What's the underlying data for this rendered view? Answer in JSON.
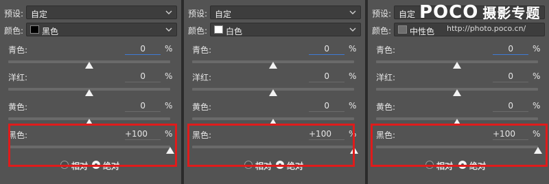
{
  "panels": [
    {
      "preset_label": "预设:",
      "preset_value": "自定",
      "color_label": "颜色:",
      "color_value": "黑色",
      "swatch_color": "#000000",
      "sliders": [
        {
          "label": "青色:",
          "value": "0",
          "unit": "%",
          "fraction": 0.5
        },
        {
          "label": "洋红:",
          "value": "0",
          "unit": "%",
          "fraction": 0.5
        },
        {
          "label": "黄色:",
          "value": "0",
          "unit": "%",
          "fraction": 0.5
        },
        {
          "label": "黑色:",
          "value": "+100",
          "unit": "%",
          "fraction": 1.0
        }
      ],
      "radio_relative": "相对",
      "radio_absolute": "绝对"
    },
    {
      "preset_label": "预设:",
      "preset_value": "自定",
      "color_label": "颜色:",
      "color_value": "白色",
      "swatch_color": "#ffffff",
      "sliders": [
        {
          "label": "青色:",
          "value": "0",
          "unit": "%",
          "fraction": 0.5
        },
        {
          "label": "洋红:",
          "value": "0",
          "unit": "%",
          "fraction": 0.5
        },
        {
          "label": "黄色:",
          "value": "0",
          "unit": "%",
          "fraction": 0.5
        },
        {
          "label": "黑色:",
          "value": "+100",
          "unit": "%",
          "fraction": 1.0
        }
      ],
      "radio_relative": "相对",
      "radio_absolute": "绝对"
    },
    {
      "preset_label": "预设:",
      "preset_value": "自定",
      "color_label": "颜色:",
      "color_value": "中性色",
      "swatch_color": "#6e6e6e",
      "sliders": [
        {
          "label": "青色:",
          "value": "0",
          "unit": "%",
          "fraction": 0.5
        },
        {
          "label": "洋红:",
          "value": "0",
          "unit": "%",
          "fraction": 0.5
        },
        {
          "label": "黄色:",
          "value": "0",
          "unit": "%",
          "fraction": 0.5
        },
        {
          "label": "黑色:",
          "value": "+100",
          "unit": "%",
          "fraction": 1.0
        }
      ],
      "radio_relative": "相对",
      "radio_absolute": "绝对"
    }
  ],
  "watermark": {
    "brand": "POCO",
    "brand_suffix": "摄影专题",
    "url": "http://photo.poco.cn/"
  },
  "colors": {
    "panel_bg": "#535353",
    "highlight": "#e01b1b",
    "active_input": "#3e7bd6"
  }
}
